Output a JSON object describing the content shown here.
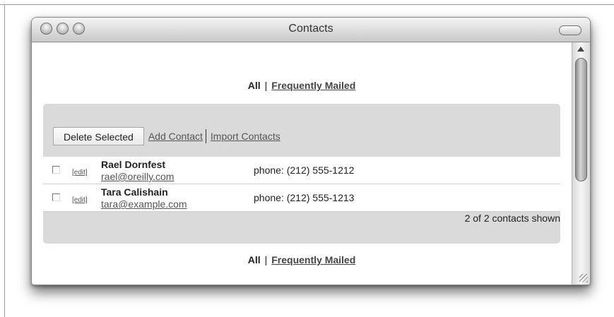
{
  "window": {
    "title": "Contacts"
  },
  "nav": {
    "all_label": "All",
    "separator": "|",
    "frequently_mailed_label": "Frequently Mailed"
  },
  "toolbar": {
    "delete_selected_label": "Delete Selected",
    "add_contact_label": "Add Contact",
    "import_contacts_label": "Import Contacts"
  },
  "contacts": [
    {
      "checked": false,
      "edit_label": "[edit]",
      "name": "Rael Dornfest",
      "email": "rael@oreilly.com",
      "phone": "phone: (212) 555-1212"
    },
    {
      "checked": false,
      "edit_label": "[edit]",
      "name": "Tara Calishain",
      "email": "tara@example.com",
      "phone": "phone: (212) 555-1213"
    }
  ],
  "status": {
    "count_text": "2 of 2 contacts shown"
  },
  "icons": {
    "close": "close-button-icon",
    "minimize": "minimize-button-icon",
    "zoom": "zoom-button-icon",
    "toolbar_toggle": "toolbar-toggle-icon",
    "scroll_up": "arrow-up-icon",
    "resize": "resize-grip-icon"
  },
  "colors": {
    "panel_bg": "#dadada",
    "window_bg": "#ffffff",
    "link": "#555555"
  }
}
